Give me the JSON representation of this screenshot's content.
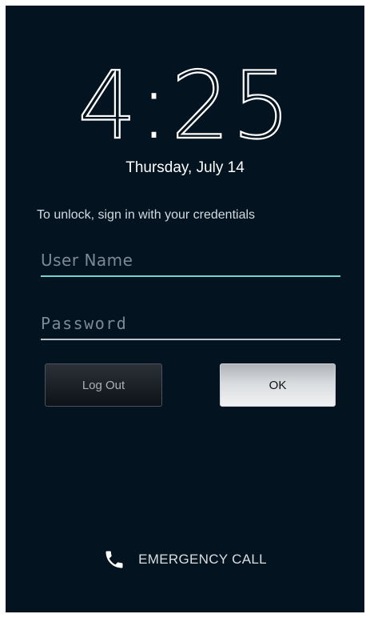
{
  "lockscreen": {
    "time_hours": "4",
    "time_separator": ":",
    "time_minutes": "25",
    "date": "Thursday, July 14",
    "hint": "To unlock, sign in with your credentials"
  },
  "form": {
    "username_placeholder": "User Name",
    "username_value": "",
    "password_placeholder": "Password",
    "password_value": ""
  },
  "buttons": {
    "logout_label": "Log Out",
    "ok_label": "OK"
  },
  "emergency": {
    "label": "EMERGENCY CALL",
    "icon": "phone-icon"
  },
  "colors": {
    "background": "#03131f",
    "focus_accent": "#71d4cf"
  }
}
